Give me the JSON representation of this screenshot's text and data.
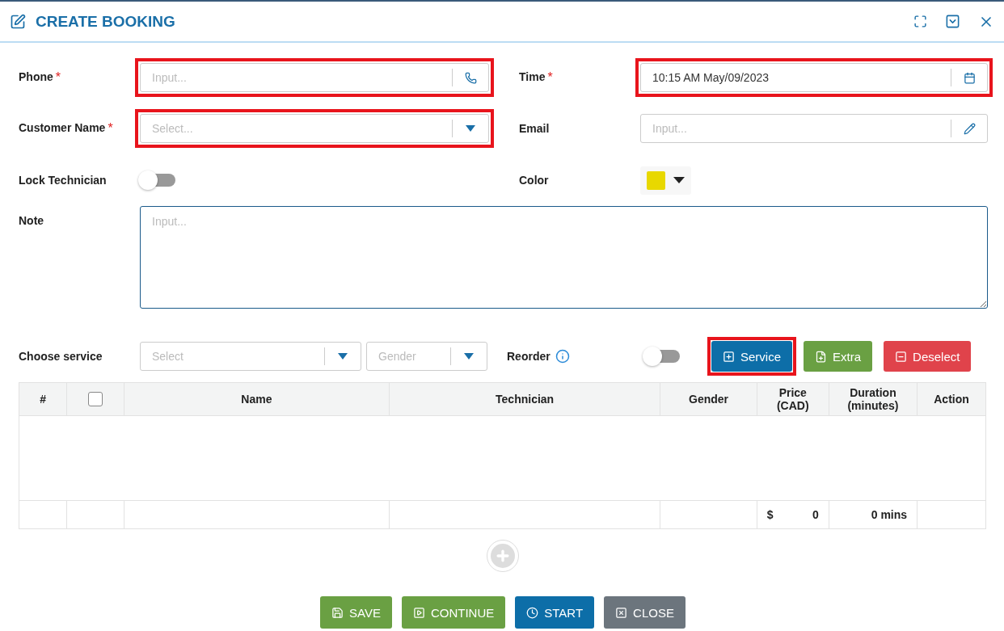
{
  "dialog": {
    "title": "CREATE BOOKING"
  },
  "fields": [
    {
      "kind": "phone",
      "label": "Phone",
      "required_mark": "*",
      "placeholder": "Input...",
      "highlighted": true
    },
    {
      "kind": "datetime",
      "label": "Time",
      "required_mark": "*",
      "value": "10:15 AM May/09/2023",
      "highlighted": true
    },
    {
      "kind": "select",
      "label": "Customer Name",
      "required_mark": "*",
      "placeholder": "Select...",
      "highlighted": true
    },
    {
      "kind": "email",
      "label": "Email",
      "placeholder": "Input...",
      "highlighted": false
    },
    {
      "kind": "toggle",
      "label": "Lock Technician",
      "on": false
    },
    {
      "kind": "color",
      "label": "Color",
      "color": "#e8d800"
    },
    {
      "kind": "textarea",
      "label": "Note",
      "placeholder": "Input..."
    }
  ],
  "service_bar": {
    "label": "Choose service",
    "service_placeholder": "Select",
    "gender_placeholder": "Gender",
    "reorder_label": "Reorder",
    "reorder_on": false,
    "buttons": [
      {
        "kind": "service",
        "label": "Service",
        "highlighted": true
      },
      {
        "kind": "extra",
        "label": "Extra",
        "highlighted": false
      },
      {
        "kind": "deselect",
        "label": "Deselect",
        "highlighted": false
      }
    ]
  },
  "table": {
    "columns": [
      {
        "kind": "text",
        "label": "#"
      },
      {
        "kind": "checkbox",
        "checked": false
      },
      {
        "kind": "text",
        "label": "Name"
      },
      {
        "kind": "text",
        "label": "Technician"
      },
      {
        "kind": "text",
        "label": "Gender"
      },
      {
        "kind": "text",
        "label": "Price (CAD)"
      },
      {
        "kind": "text",
        "label": "Duration (minutes)"
      },
      {
        "kind": "text",
        "label": "Action"
      }
    ],
    "totals": {
      "currency": "$",
      "price": "0",
      "duration": "0 mins"
    }
  },
  "actions": [
    {
      "kind": "save",
      "label": "SAVE"
    },
    {
      "kind": "continue",
      "label": "CONTINUE"
    },
    {
      "kind": "start",
      "label": "START"
    },
    {
      "kind": "close",
      "label": "CLOSE"
    }
  ]
}
